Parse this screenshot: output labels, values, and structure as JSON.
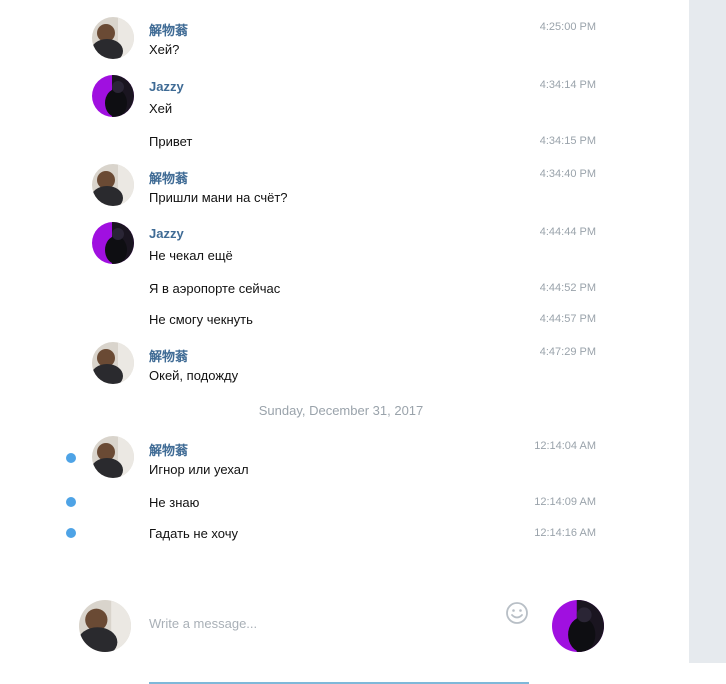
{
  "messages": [
    {
      "sender": "解物蓊",
      "text": "Хей?",
      "time": "4:25:00 PM"
    },
    {
      "sender": "Jazzy",
      "text": "Хей",
      "time": "4:34:14 PM"
    },
    {
      "text": "Привет",
      "time": "4:34:15 PM"
    },
    {
      "sender": "解物蓊",
      "text": "Пришли мани на счёт?",
      "time": "4:34:40 PM"
    },
    {
      "sender": "Jazzy",
      "text": "Не чекал ещё",
      "time": "4:44:44 PM"
    },
    {
      "text": "Я в аэропорте сейчас",
      "time": "4:44:52 PM"
    },
    {
      "text": "Не смогу чекнуть",
      "time": "4:44:57 PM"
    },
    {
      "sender": "解物蓊",
      "text": "Окей, подожду",
      "time": "4:47:29 PM"
    },
    {
      "sender": "解物蓊",
      "text": "Игнор или уехал",
      "time": "12:14:04 AM"
    },
    {
      "text": "Не знаю",
      "time": "12:14:09 AM"
    },
    {
      "text": "Гадать не хочу",
      "time": "12:14:16 AM"
    }
  ],
  "date_separator": "Sunday, December 31, 2017",
  "compose": {
    "placeholder": "Write a message..."
  },
  "colors": {
    "sender": "#3f6b95",
    "unread": "#4ea3e6",
    "jazzy_avatar": "#a010e0"
  }
}
